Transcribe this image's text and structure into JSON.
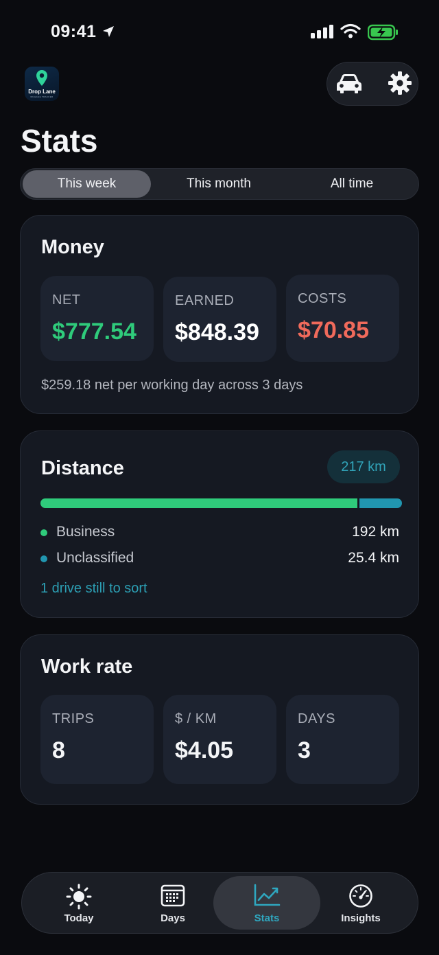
{
  "status_bar": {
    "time": "09:41",
    "location_icon": "location-arrow-icon",
    "signal_icon": "cellular-signal-icon",
    "wifi_icon": "wifi-icon",
    "battery_icon": "battery-charging-icon"
  },
  "app": {
    "logo_text": "Drop Lane",
    "logo_tagline": "MILEAGE TRACKER",
    "logo_icon": "map-pin-icon"
  },
  "header": {
    "vehicle_icon": "car-icon",
    "settings_icon": "gear-icon"
  },
  "page_title": "Stats",
  "range_tabs": [
    {
      "label": "This week",
      "active": true
    },
    {
      "label": "This month",
      "active": false
    },
    {
      "label": "All time",
      "active": false
    }
  ],
  "money": {
    "title": "Money",
    "tiles": [
      {
        "label": "NET",
        "value": "$777.54",
        "color": "#2fcb7b"
      },
      {
        "label": "EARNED",
        "value": "$848.39",
        "color": "#ffffff"
      },
      {
        "label": "COSTS",
        "value": "$70.85",
        "color": "#f06a5b"
      }
    ],
    "note": "$259.18 net per working day across 3 days"
  },
  "distance": {
    "title": "Distance",
    "total": "217 km",
    "business_share": 0.883,
    "rows": [
      {
        "label": "Business",
        "value": "192 km",
        "color": "#2fcb7b"
      },
      {
        "label": "Unclassified",
        "value": "25.4 km",
        "color": "#2196b0"
      }
    ],
    "link": "1 drive still to sort"
  },
  "work_rate": {
    "title": "Work rate",
    "tiles": [
      {
        "label": "TRIPS",
        "value": "8"
      },
      {
        "label": "$ / KM",
        "value": "$4.05"
      },
      {
        "label": "DAYS",
        "value": "3"
      }
    ]
  },
  "tab_bar": [
    {
      "label": "Today",
      "icon": "sun-icon",
      "active": false
    },
    {
      "label": "Days",
      "icon": "calendar-icon",
      "active": false
    },
    {
      "label": "Stats",
      "icon": "chart-line-icon",
      "active": true
    },
    {
      "label": "Insights",
      "icon": "speedometer-icon",
      "active": false
    }
  ],
  "colors": {
    "accent": "#2fa7bf",
    "positive": "#2fcb7b",
    "negative": "#f06a5b",
    "background": "#0a0b0f",
    "card": "#151922"
  }
}
